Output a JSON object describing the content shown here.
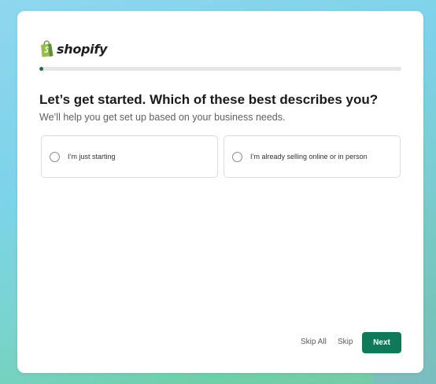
{
  "brand": {
    "name": "shopify",
    "logo_icon": "shopify-bag-icon",
    "accent_color": "#95bf47",
    "primary_color": "#0f7a5a"
  },
  "progress": {
    "fraction": 0.01
  },
  "question": {
    "title": "Let’s get started. Which of these best describes you?",
    "subtitle": "We’ll help you get set up based on your business needs."
  },
  "options": [
    {
      "label": "I’m just starting",
      "selected": false
    },
    {
      "label": "I’m already selling online or in person",
      "selected": false
    }
  ],
  "footer": {
    "skip_all_label": "Skip All",
    "skip_label": "Skip",
    "next_label": "Next"
  }
}
